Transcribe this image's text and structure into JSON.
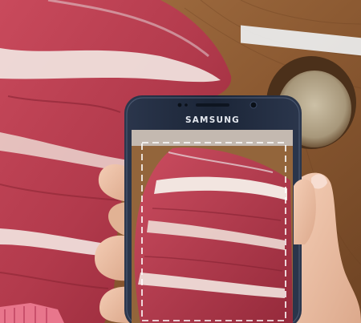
{
  "phone": {
    "brand": "SAMSUNG"
  },
  "colors": {
    "board": "#8a5a33",
    "meat": "#b23a4c",
    "fat": "#f1e4df",
    "phone_body": "#1f2a3e",
    "scan_frame": "#ffffff"
  }
}
